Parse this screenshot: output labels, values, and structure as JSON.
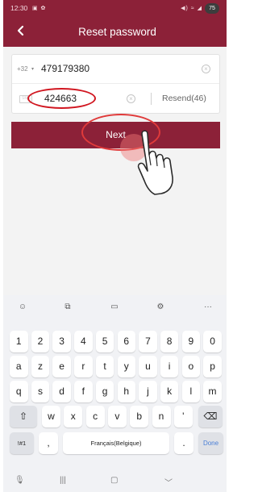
{
  "status_bar": {
    "time": "12:30",
    "left_icons": "▣ ✿",
    "right_icons": "◀) ≈ ◢",
    "battery": "75"
  },
  "header": {
    "back_icon": "chevron-left-icon",
    "title": "Reset password"
  },
  "form": {
    "country_code": "+32",
    "phone_value": "479179380",
    "code_value": "424663",
    "sms_icon_text": "SMS",
    "resend_label": "Resend(46)"
  },
  "next_button": {
    "label": "Next"
  },
  "keyboard": {
    "toolbar": [
      "emoji-icon",
      "translate-icon",
      "clipboard-icon",
      "settings-icon",
      "more-icon"
    ],
    "rows": [
      [
        "1",
        "2",
        "3",
        "4",
        "5",
        "6",
        "7",
        "8",
        "9",
        "0"
      ],
      [
        "a",
        "z",
        "e",
        "r",
        "t",
        "y",
        "u",
        "i",
        "o",
        "p"
      ],
      [
        "q",
        "s",
        "d",
        "f",
        "g",
        "h",
        "j",
        "k",
        "l",
        "m"
      ],
      [
        "w",
        "x",
        "c",
        "v",
        "b",
        "n",
        "'"
      ]
    ],
    "symbols_label": "!#1",
    "comma": ",",
    "space_label": "Français(Belgique)",
    "period": ".",
    "done_label": "Done"
  },
  "colors": {
    "brand": "#8c2138",
    "annotation": "#d11620",
    "done_blue": "#4a7fd6"
  }
}
